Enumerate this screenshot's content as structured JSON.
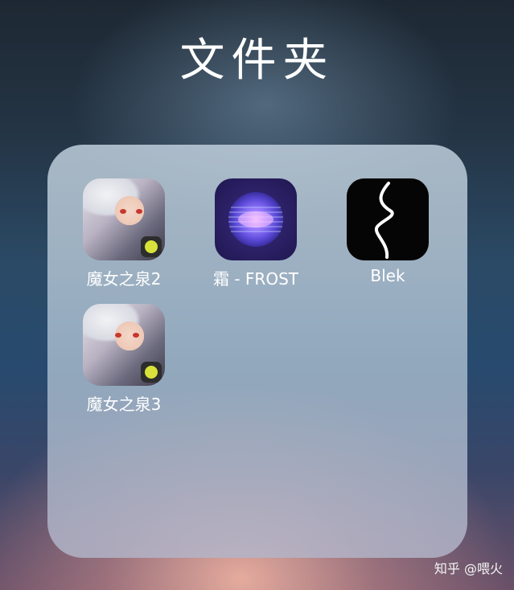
{
  "folder": {
    "title": "文件夹",
    "apps": [
      {
        "label": "魔女之泉2",
        "icon": "mojo-zhiquan-2-app-icon"
      },
      {
        "label": "霜 - FROST",
        "icon": "frost-app-icon"
      },
      {
        "label": "Blek",
        "icon": "blek-app-icon"
      },
      {
        "label": "魔女之泉3",
        "icon": "mojo-zhiquan-3-app-icon"
      }
    ]
  },
  "watermark": "知乎 @喂火"
}
